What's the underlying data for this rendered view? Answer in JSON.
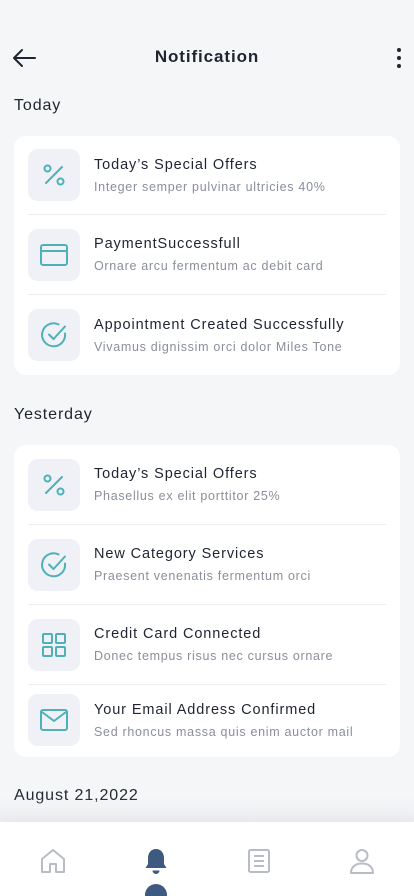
{
  "header": {
    "title": "Notification",
    "back_icon": "arrow-left-icon",
    "more_icon": "more-vertical-icon"
  },
  "colors": {
    "accent_teal": "#4fb0b6",
    "nav_active": "#3e5a80",
    "nav_inactive": "#b7bcc6",
    "icon_bg": "#eff1f6"
  },
  "sections": [
    {
      "title": "Today",
      "items": [
        {
          "icon": "percent-icon",
          "title": "Today’s Special Offers",
          "subtitle": "Integer semper pulvinar ultricies 40%"
        },
        {
          "icon": "credit-card-icon",
          "title": "PaymentSuccessfull",
          "subtitle": "Ornare arcu fermentum ac debit card"
        },
        {
          "icon": "check-circle-icon",
          "title": "Appointment Created Successfully",
          "subtitle": "Vivamus dignissim orci dolor Miles Tone"
        }
      ]
    },
    {
      "title": "Yesterday",
      "items": [
        {
          "icon": "percent-icon",
          "title": "Today’s Special Offers",
          "subtitle": "Phasellus ex elit porttitor 25%"
        },
        {
          "icon": "check-circle-icon",
          "title": "New Category Services",
          "subtitle": "Praesent venenatis fermentum orci"
        },
        {
          "icon": "grid-icon",
          "title": "Credit Card Connected",
          "subtitle": "Donec tempus risus nec cursus ornare"
        },
        {
          "icon": "mail-icon",
          "title": "Your Email Address Confirmed",
          "subtitle": "Sed rhoncus massa quis enim auctor mail"
        }
      ]
    },
    {
      "title": "August 21,2022",
      "items": []
    }
  ],
  "bottom_nav": {
    "items": [
      {
        "icon": "home-icon",
        "active": false
      },
      {
        "icon": "bell-icon",
        "active": true
      },
      {
        "icon": "document-icon",
        "active": false
      },
      {
        "icon": "user-icon",
        "active": false
      }
    ]
  }
}
